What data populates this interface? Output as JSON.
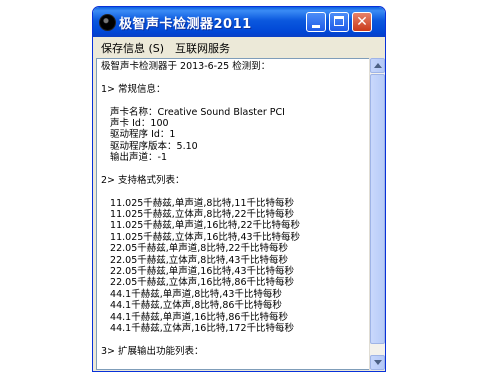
{
  "window": {
    "title": "极智声卡检测器2011",
    "app_icon": "black-ball-icon",
    "buttons": {
      "minimize": "minimize-icon",
      "maximize": "maximize-icon",
      "close": "close-icon",
      "close_glyph": "✕"
    }
  },
  "menu": {
    "items": [
      {
        "label": "保存信息 (S)"
      },
      {
        "label": "互联网服务"
      }
    ]
  },
  "report": {
    "lines": [
      "极智声卡检测器于 2013-6-25 检测到：",
      "",
      "1> 常规信息：",
      "",
      "   声卡名称：Creative Sound Blaster PCI",
      "   声卡 Id：100",
      "   驱动程序 Id：1",
      "   驱动程序版本：5.10",
      "   输出声道：-1",
      "",
      "2> 支持格式列表：",
      "",
      "   11.025千赫兹,单声道,8比特,11千比特每秒",
      "   11.025千赫兹,立体声,8比特,22千比特每秒",
      "   11.025千赫兹,单声道,16比特,22千比特每秒",
      "   11.025千赫兹,立体声,16比特,43千比特每秒",
      "   22.05千赫兹,单声道,8比特,22千比特每秒",
      "   22.05千赫兹,立体声,8比特,43千比特每秒",
      "   22.05千赫兹,单声道,16比特,43千比特每秒",
      "   22.05千赫兹,立体声,16比特,86千比特每秒",
      "   44.1千赫兹,单声道,8比特,43千比特每秒",
      "   44.1千赫兹,立体声,8比特,86千比特每秒",
      "   44.1千赫兹,单声道,16比特,86千比特每秒",
      "   44.1千赫兹,立体声,16比特,172千比特每秒",
      "",
      "3> 扩展输出功能列表："
    ]
  },
  "colors": {
    "titlebar": "#0054e3",
    "close_button": "#d8502e",
    "window_face": "#ece9d8"
  }
}
